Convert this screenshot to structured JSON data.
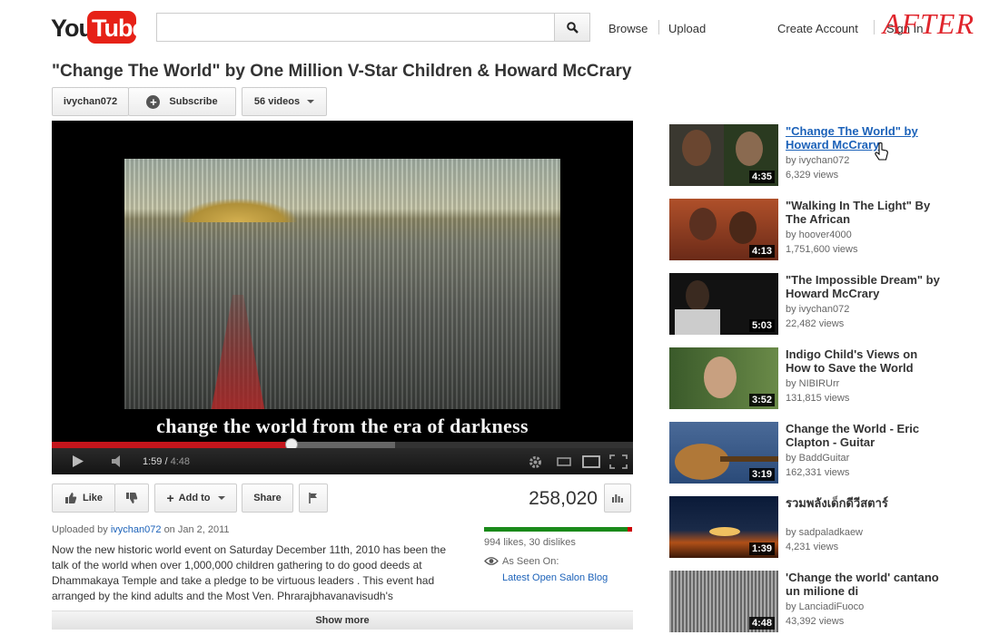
{
  "header": {
    "logo_you": "You",
    "logo_tube": "Tube",
    "search_placeholder": "",
    "links": [
      "Browse",
      "Upload",
      "Create Account",
      "Sign In"
    ],
    "overlay_label": "AFTER"
  },
  "video": {
    "title": "\"Change The World\" by One Million V-Star Children & Howard McCrary",
    "channel": "ivychan072",
    "subscribe_label": "Subscribe",
    "videos_label": "56 videos",
    "subtitle": "change the world from the era of darkness",
    "time_current": "1:59",
    "time_total": "4:48",
    "progress_played": 0.413,
    "progress_loaded": 0.59,
    "views": "258,020",
    "likes_ratio": 0.97,
    "likes_text": "994 likes, 30 dislikes",
    "uploaded_prefix": "Uploaded by",
    "uploaded_by": "ivychan072",
    "uploaded_date": "on Jan 2, 2011",
    "description": "Now the new historic world event on Saturday December 11th, 2010 has been the talk of the world when over 1,000,000 children gathering to do good deeds at Dhammakaya Temple and take a pledge to be virtuous leaders . This event had arranged by the kind adults and the Most Ven. Phrarajbhavanavisudh's",
    "as_seen_on": "As Seen On:",
    "seen_link": "Latest Open Salon Blog",
    "show_more": "Show more"
  },
  "actions": {
    "like": "Like",
    "add_to": "Add to",
    "share": "Share"
  },
  "related": [
    {
      "title": "\"Change The World\" by Howard McCrary",
      "by": "by ivychan072",
      "views": "6,329 views",
      "duration": "4:35",
      "hover": true
    },
    {
      "title": "\"Walking In The Light\" By The African",
      "by": "by hoover4000",
      "views": "1,751,600 views",
      "duration": "4:13",
      "hover": false
    },
    {
      "title": "\"The Impossible Dream\" by Howard McCrary",
      "by": "by ivychan072",
      "views": "22,482 views",
      "duration": "5:03",
      "hover": false
    },
    {
      "title": "Indigo Child's Views on How to Save the World",
      "by": "by NIBIRUrr",
      "views": "131,815 views",
      "duration": "3:52",
      "hover": false
    },
    {
      "title": "Change the World - Eric Clapton - Guitar",
      "by": "by BaddGuitar",
      "views": "162,331 views",
      "duration": "3:19",
      "hover": false
    },
    {
      "title": "รวมพลังเด็กดีวีสตาร์",
      "by": "by sadpaladkaew",
      "views": "4,231 views",
      "duration": "1:39",
      "hover": false
    },
    {
      "title": "'Change the world' cantano un milione di",
      "by": "by LanciadiFuoco",
      "views": "43,392 views",
      "duration": "4:48",
      "hover": false
    }
  ],
  "colors": {
    "brand_red": "#e62117",
    "link_blue": "#1c62b9",
    "like_green": "#1a8a1a",
    "dislike_red": "#cc0000",
    "after_red": "#e0252c"
  },
  "icons": [
    "search-icon",
    "plus-circle-icon",
    "thumbs-up-icon",
    "thumbs-down-icon",
    "flag-icon",
    "stats-icon",
    "play-icon",
    "volume-icon",
    "gear-icon",
    "eye-icon",
    "hand-cursor-icon"
  ]
}
